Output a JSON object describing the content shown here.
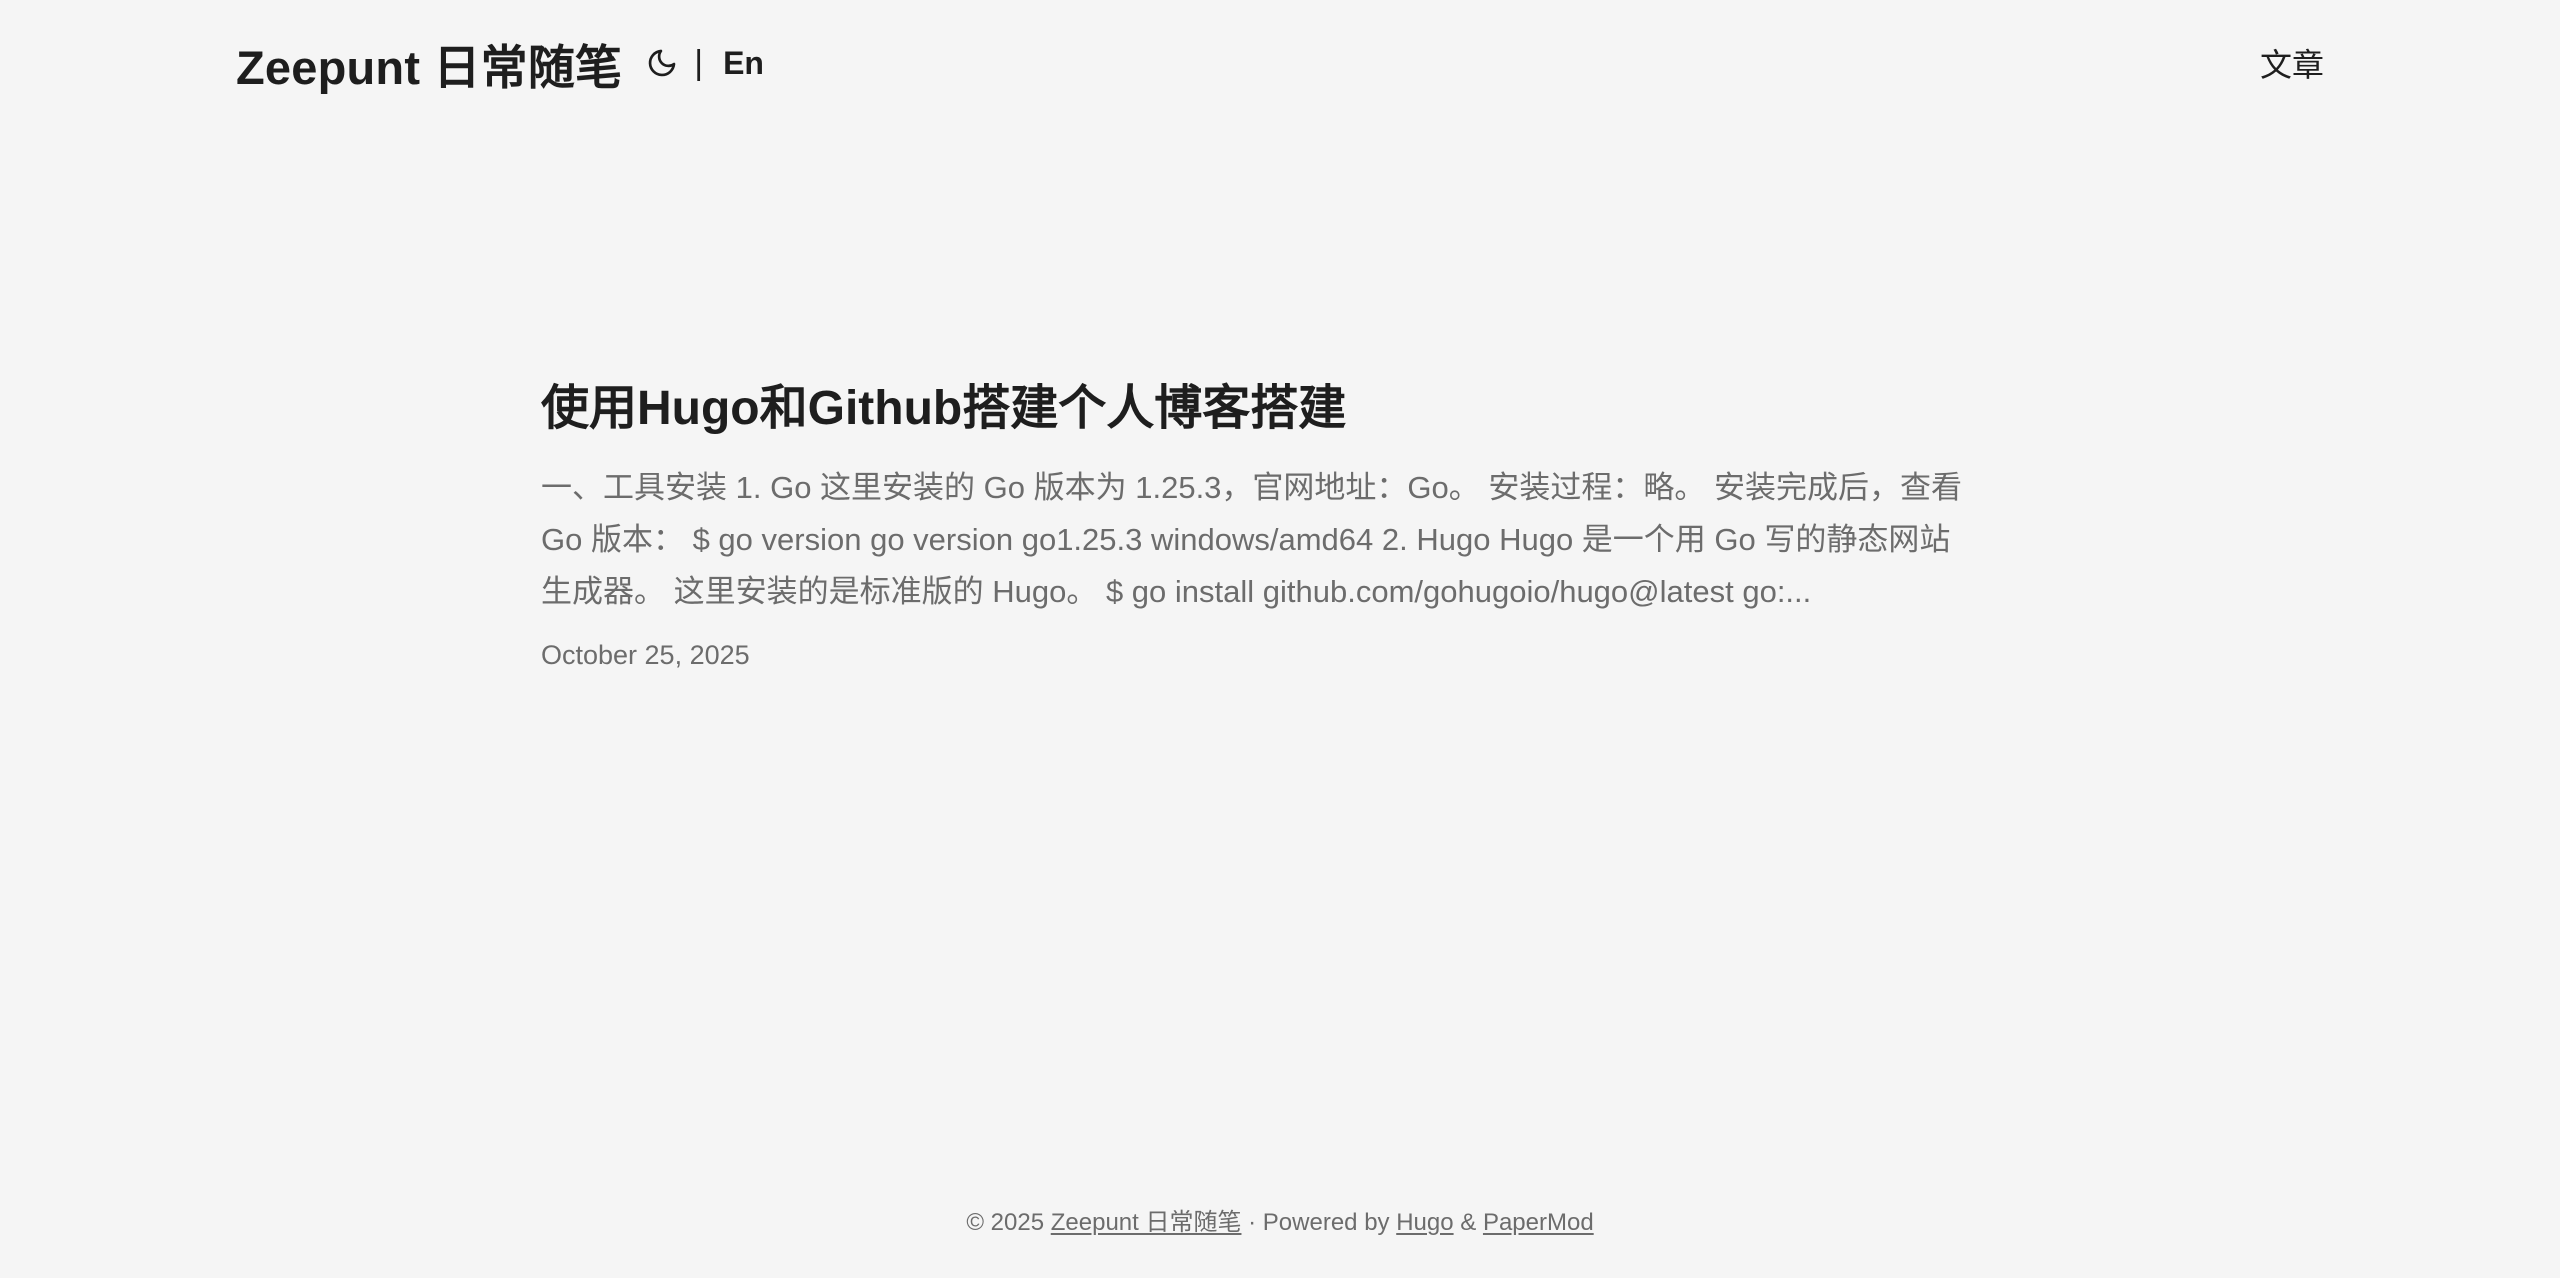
{
  "header": {
    "logo_text": "Zeepunt 日常随笔",
    "theme_toggle_icon": "moon-icon",
    "lang_separator": "|",
    "lang_switch": "En",
    "menu": [
      {
        "label": "文章"
      }
    ]
  },
  "post": {
    "title": "使用Hugo和Github搭建个人博客搭建",
    "summary": "一、工具安装 1. Go 这里安装的 Go 版本为 1.25.3，官网地址：Go。 安装过程：略。 安装完成后，查看 Go 版本： $ go version go version go1.25.3 windows/amd64 2. Hugo Hugo 是一个用 Go 写的静态网站生成器。 这里安装的是标准版的 Hugo。 $ go install github.com/gohugoio/hugo@latest go:...",
    "date": "October 25, 2025"
  },
  "footer": {
    "copyright": "© 2025",
    "site_link": "Zeepunt 日常随笔",
    "powered_by": "· Powered by",
    "hugo_link": "Hugo",
    "amp": "&",
    "theme_link": "PaperMod"
  },
  "colors": {
    "background": "#f5f5f5",
    "primary_text": "#1e1e1e",
    "secondary_text": "#6c6c6c"
  }
}
